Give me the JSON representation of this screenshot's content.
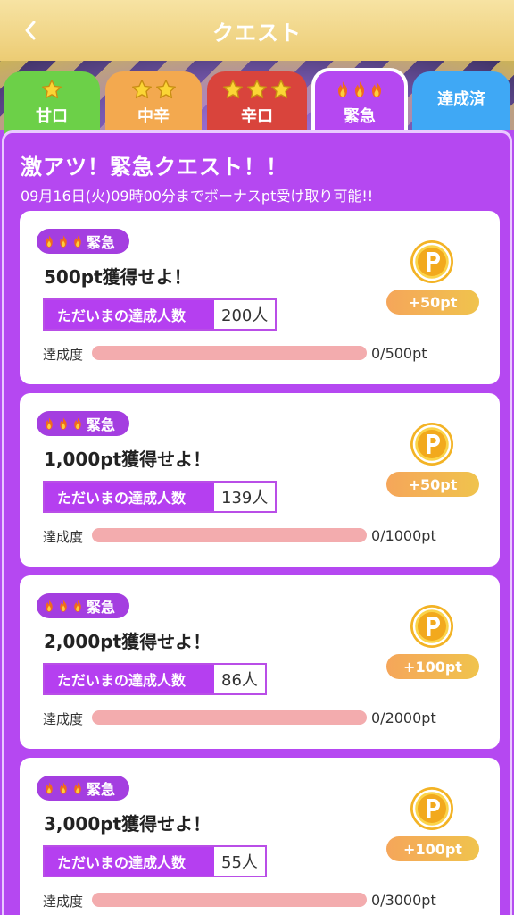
{
  "header": {
    "title": "クエスト"
  },
  "tabs": [
    {
      "label": "甘口",
      "stars": 1
    },
    {
      "label": "中辛",
      "stars": 2
    },
    {
      "label": "辛口",
      "stars": 3
    },
    {
      "label": "緊急",
      "flames": 3,
      "active": true
    },
    {
      "label": "達成済"
    }
  ],
  "panel": {
    "title": "激アツ！緊急クエスト！！",
    "subtitle": "09月16日(火)09時00分までボーナスpt受け取り可能!!"
  },
  "quests": [
    {
      "badge": "緊急",
      "title": "500pt獲得せよ！",
      "counter_label": "ただいまの達成人数",
      "counter_value": "200人",
      "progress_label": "達成度",
      "progress_text": "0/500pt",
      "progress_fraction": 0,
      "reward": "+50pt",
      "coin_icon": "p-coin-icon"
    },
    {
      "badge": "緊急",
      "title": "1,000pt獲得せよ！",
      "counter_label": "ただいまの達成人数",
      "counter_value": "139人",
      "progress_label": "達成度",
      "progress_text": "0/1000pt",
      "progress_fraction": 0,
      "reward": "+50pt",
      "coin_icon": "p-coin-icon"
    },
    {
      "badge": "緊急",
      "title": "2,000pt獲得せよ！",
      "counter_label": "ただいまの達成人数",
      "counter_value": "86人",
      "progress_label": "達成度",
      "progress_text": "0/2000pt",
      "progress_fraction": 0,
      "reward": "+100pt",
      "coin_icon": "p-coin-icon"
    },
    {
      "badge": "緊急",
      "title": "3,000pt獲得せよ！",
      "counter_label": "ただいまの達成人数",
      "counter_value": "55人",
      "progress_label": "達成度",
      "progress_text": "0/3000pt",
      "progress_fraction": 0,
      "reward": "+100pt",
      "coin_icon": "p-coin-icon"
    }
  ],
  "colors": {
    "header_gold": "#eccc74",
    "panel_purple": "#b548f1",
    "tab_green": "#6cd048",
    "tab_orange": "#f3a94f",
    "tab_red": "#d9443c",
    "tab_blue": "#3fa8f5",
    "progress_track": "#f3acae",
    "reward_orange": "#f5a65a"
  }
}
